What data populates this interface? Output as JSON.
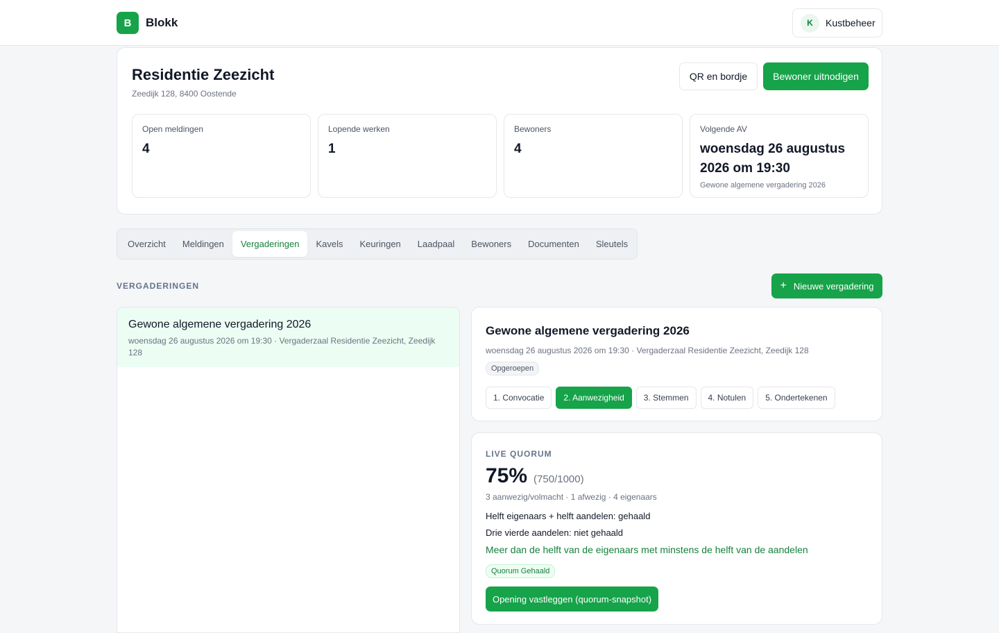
{
  "app": {
    "logo_letter": "B",
    "name": "Blokk",
    "user_initial": "K",
    "user_name": "Kustbeheer"
  },
  "building": {
    "title": "Residentie Zeezicht",
    "address": "Zeedijk 128, 8400 Oostende",
    "qr_button": "QR en bordje",
    "invite_button": "Bewoner uitnodigen"
  },
  "stats": [
    {
      "label": "Open meldingen",
      "value": "4",
      "sub": ""
    },
    {
      "label": "Lopende werken",
      "value": "1",
      "sub": ""
    },
    {
      "label": "Bewoners",
      "value": "4",
      "sub": ""
    },
    {
      "label": "Volgende AV",
      "value": "woensdag 26 augustus 2026 om 19:30",
      "sub": "Gewone algemene vergadering 2026"
    }
  ],
  "tabs": [
    "Overzicht",
    "Meldingen",
    "Vergaderingen",
    "Kavels",
    "Keuringen",
    "Laadpaal",
    "Bewoners",
    "Documenten",
    "Sleutels"
  ],
  "active_tab": "Vergaderingen",
  "section": {
    "title": "VERGADERINGEN",
    "new_button_icon": "plus-icon",
    "new_button": "Nieuwe vergadering"
  },
  "meeting_list": [
    {
      "title": "Gewone algemene vergadering 2026",
      "sub": "woensdag 26 augustus 2026 om 19:30 · Vergaderzaal Residentie Zeezicht, Zeedijk 128"
    }
  ],
  "meeting": {
    "title": "Gewone algemene vergadering 2026",
    "sub": "woensdag 26 augustus 2026 om 19:30 · Vergaderzaal Residentie Zeezicht, Zeedijk 128",
    "status": "Opgeroepen",
    "steps": [
      "1. Convocatie",
      "2. Aanwezigheid",
      "3. Stemmen",
      "4. Notulen",
      "5. Ondertekenen"
    ],
    "active_step": "2. Aanwezigheid"
  },
  "quorum": {
    "label": "LIVE QUORUM",
    "percent": "75%",
    "fraction": "(750/1000)",
    "counts": "3 aanwezig/volmacht · 1 afwezig · 4 eigenaars",
    "line1": "Helft eigenaars + helft aandelen: gehaald",
    "line2": "Drie vierde aandelen: niet gehaald",
    "rule": "Meer dan de helft van de eigenaars met minstens de helft van de aandelen",
    "badge": "Quorum Gehaald",
    "button": "Opening vastleggen (quorum-snapshot)"
  },
  "colors": {
    "accent": "#16a34a",
    "accent_text": "#15803d",
    "selected_bg": "#ecfdf3"
  }
}
